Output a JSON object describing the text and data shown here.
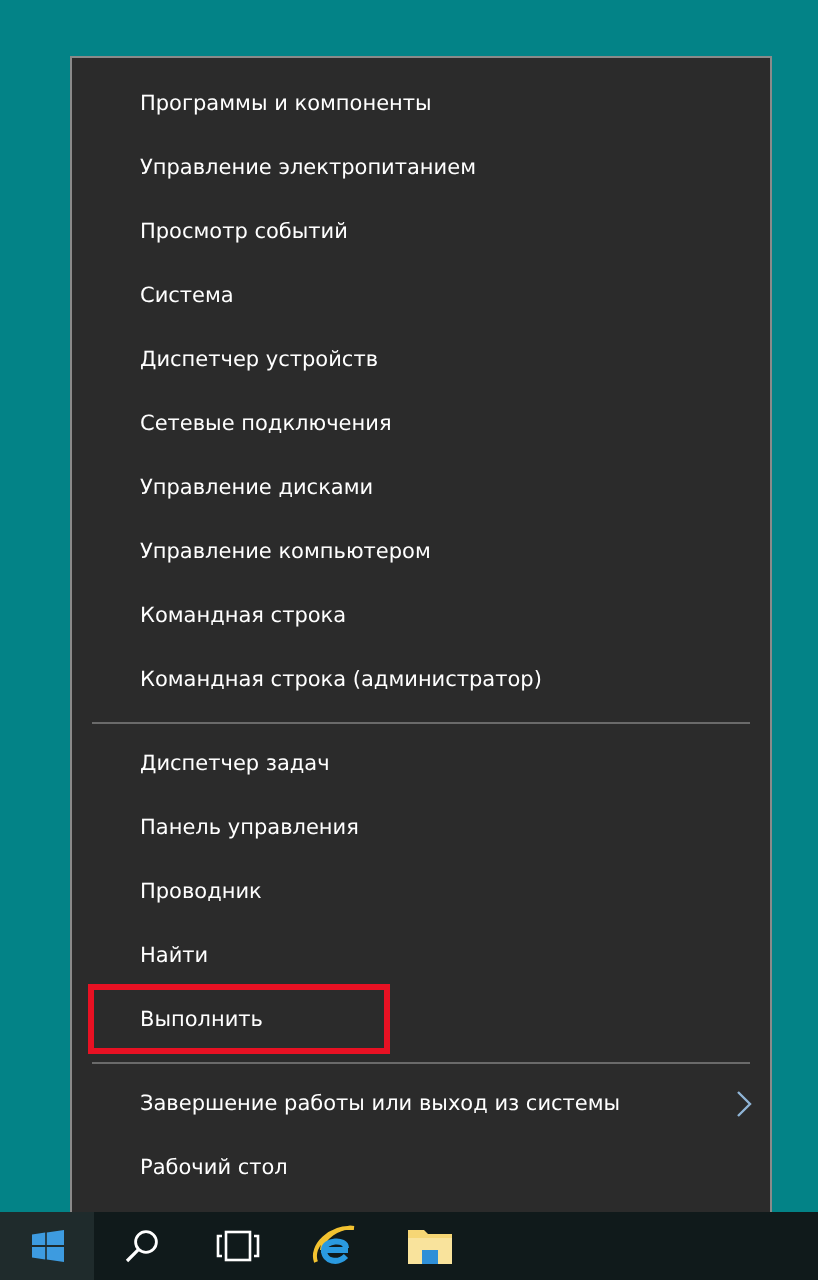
{
  "menu": {
    "groups": [
      {
        "items": [
          {
            "label": "Программы и компоненты",
            "highlighted": false,
            "has_submenu": false
          },
          {
            "label": "Управление электропитанием",
            "highlighted": false,
            "has_submenu": false
          },
          {
            "label": "Просмотр событий",
            "highlighted": false,
            "has_submenu": false
          },
          {
            "label": "Система",
            "highlighted": false,
            "has_submenu": false
          },
          {
            "label": "Диспетчер устройств",
            "highlighted": false,
            "has_submenu": false
          },
          {
            "label": "Сетевые подключения",
            "highlighted": false,
            "has_submenu": false
          },
          {
            "label": "Управление дисками",
            "highlighted": false,
            "has_submenu": false
          },
          {
            "label": "Управление компьютером",
            "highlighted": false,
            "has_submenu": false
          },
          {
            "label": "Командная строка",
            "highlighted": false,
            "has_submenu": false
          },
          {
            "label": "Командная строка (администратор)",
            "highlighted": false,
            "has_submenu": false
          }
        ]
      },
      {
        "items": [
          {
            "label": "Диспетчер задач",
            "highlighted": false,
            "has_submenu": false
          },
          {
            "label": "Панель управления",
            "highlighted": false,
            "has_submenu": false
          },
          {
            "label": "Проводник",
            "highlighted": false,
            "has_submenu": false
          },
          {
            "label": "Найти",
            "highlighted": false,
            "has_submenu": false
          },
          {
            "label": "Выполнить",
            "highlighted": true,
            "has_submenu": false
          }
        ]
      },
      {
        "items": [
          {
            "label": "Завершение работы или выход из системы",
            "highlighted": false,
            "has_submenu": true
          },
          {
            "label": "Рабочий стол",
            "highlighted": false,
            "has_submenu": false
          }
        ]
      }
    ]
  },
  "taskbar": {
    "buttons": [
      {
        "kind": "start"
      },
      {
        "kind": "search"
      },
      {
        "kind": "taskview"
      },
      {
        "kind": "browser"
      },
      {
        "kind": "folder"
      }
    ]
  }
}
